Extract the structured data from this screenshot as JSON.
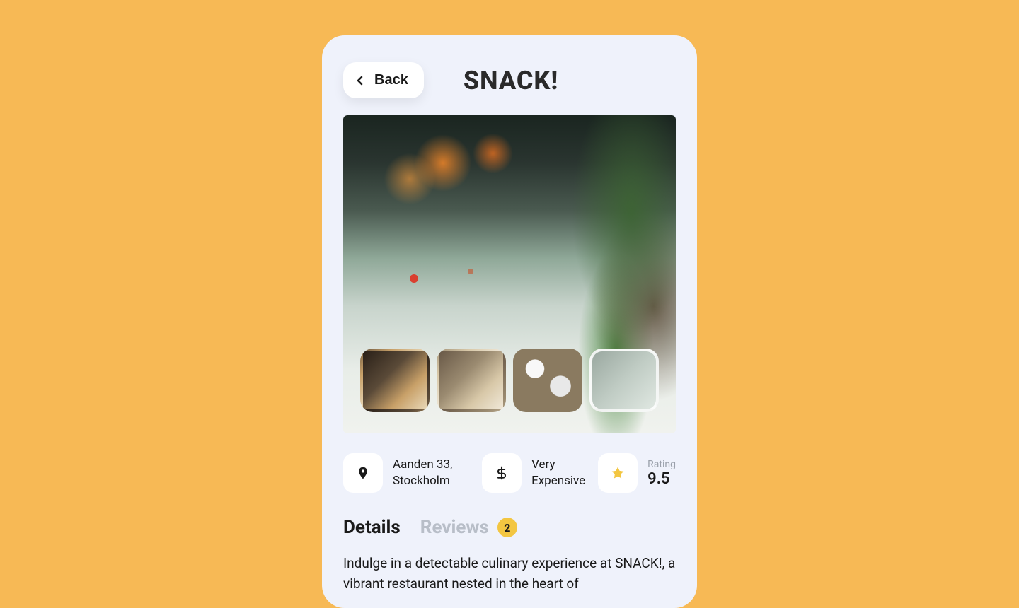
{
  "header": {
    "back_label": "Back",
    "title": "SNACK!"
  },
  "info": {
    "location": "Aanden 33, Stockholm",
    "price": "Very Expensive",
    "rating_label": "Rating",
    "rating_value": "9.5"
  },
  "tabs": {
    "details_label": "Details",
    "reviews_label": "Reviews",
    "reviews_count": "2"
  },
  "description": "Indulge in a detectable culinary experience at SNACK!, a vibrant restaurant nested in the heart of"
}
